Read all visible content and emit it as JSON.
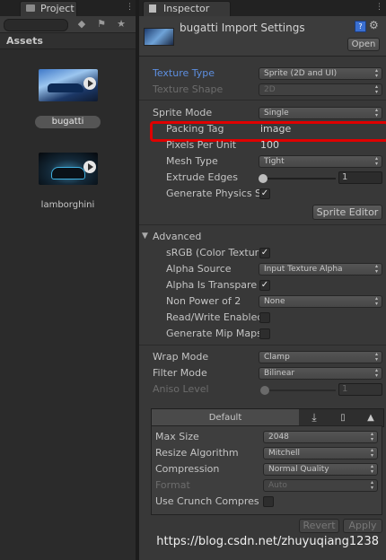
{
  "project": {
    "tab_label": "Project",
    "breadcrumb": "Assets",
    "assets": [
      {
        "name": "bugatti",
        "selected": true
      },
      {
        "name": "lamborghini",
        "selected": false
      }
    ]
  },
  "inspector": {
    "tab_label": "Inspector",
    "title": "bugatti Import Settings",
    "open_button": "Open",
    "texture_type": {
      "label": "Texture Type",
      "value": "Sprite (2D and UI)"
    },
    "texture_shape": {
      "label": "Texture Shape",
      "value": "2D"
    },
    "sprite_mode": {
      "label": "Sprite Mode",
      "value": "Single"
    },
    "packing_tag": {
      "label": "Packing Tag",
      "value": "image"
    },
    "pixels_per_unit": {
      "label": "Pixels Per Unit",
      "value": "100"
    },
    "mesh_type": {
      "label": "Mesh Type",
      "value": "Tight"
    },
    "extrude_edges": {
      "label": "Extrude Edges",
      "value": "1"
    },
    "generate_physics": {
      "label": "Generate Physics Sł",
      "checked": true
    },
    "sprite_editor_button": "Sprite Editor",
    "advanced": {
      "label": "Advanced",
      "srgb": {
        "label": "sRGB (Color Textur",
        "checked": true
      },
      "alpha_source": {
        "label": "Alpha Source",
        "value": "Input Texture Alpha"
      },
      "alpha_transparency": {
        "label": "Alpha Is Transpare",
        "checked": true
      },
      "non_power_of_2": {
        "label": "Non Power of 2",
        "value": "None"
      },
      "read_write": {
        "label": "Read/Write Enablec",
        "checked": false
      },
      "generate_mip_maps": {
        "label": "Generate Mip Maps",
        "checked": false
      }
    },
    "wrap_mode": {
      "label": "Wrap Mode",
      "value": "Clamp"
    },
    "filter_mode": {
      "label": "Filter Mode",
      "value": "Bilinear"
    },
    "aniso_level": {
      "label": "Aniso Level",
      "value": "1"
    },
    "platform": {
      "tab_default": "Default",
      "max_size": {
        "label": "Max Size",
        "value": "2048"
      },
      "resize_algorithm": {
        "label": "Resize Algorithm",
        "value": "Mitchell"
      },
      "compression": {
        "label": "Compression",
        "value": "Normal Quality"
      },
      "format": {
        "label": "Format",
        "value": "Auto"
      },
      "use_crunch": {
        "label": "Use Crunch Compres",
        "checked": false
      }
    },
    "revert_button": "Revert",
    "apply_button": "Apply"
  },
  "watermark": "https://blog.csdn.net/zhuyuqiang1238",
  "colors": {
    "highlight": "#e00000",
    "label_accent": "#5d8fe0"
  }
}
